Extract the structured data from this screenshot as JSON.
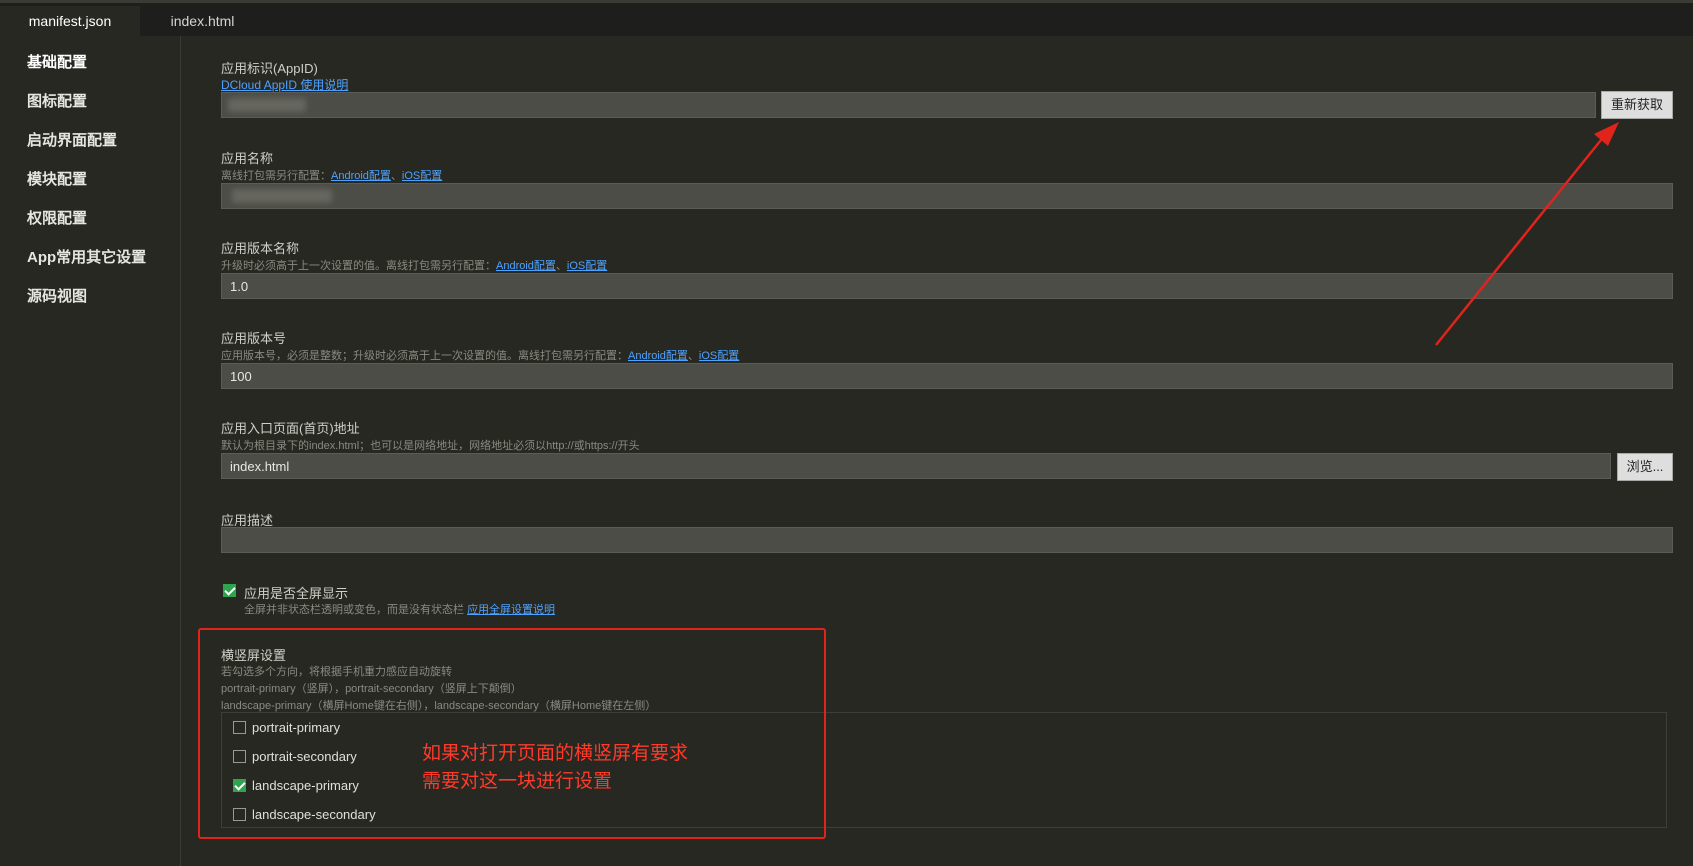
{
  "tabs": [
    {
      "label": "manifest.json",
      "active": true
    },
    {
      "label": "index.html",
      "active": false
    }
  ],
  "sidebar": {
    "items": [
      {
        "label": "基础配置",
        "active": true
      },
      {
        "label": "图标配置"
      },
      {
        "label": "启动界面配置"
      },
      {
        "label": "模块配置"
      },
      {
        "label": "权限配置"
      },
      {
        "label": "App常用其它设置"
      },
      {
        "label": "源码视图"
      }
    ]
  },
  "form": {
    "appid": {
      "label": "应用标识(AppID)",
      "help_link": "DCloud AppID 使用说明",
      "value": "",
      "button": "重新获取"
    },
    "name": {
      "label": "应用名称",
      "hint_prefix": "离线打包需另行配置：",
      "link_android": "Android配置",
      "sep": "、",
      "link_ios": "iOS配置",
      "value": ""
    },
    "version_name": {
      "label": "应用版本名称",
      "hint_prefix": "升级时必须高于上一次设置的值。离线打包需另行配置：",
      "link_android": "Android配置",
      "sep": "、",
      "link_ios": "iOS配置",
      "value": "1.0"
    },
    "version_code": {
      "label": "应用版本号",
      "hint_prefix": "应用版本号，必须是整数；升级时必须高于上一次设置的值。离线打包需另行配置：",
      "link_android": "Android配置",
      "sep": "、",
      "link_ios": "iOS配置",
      "value": "100"
    },
    "entry": {
      "label": "应用入口页面(首页)地址",
      "hint": "默认为根目录下的index.html；也可以是网络地址，网络地址必须以http://或https://开头",
      "value": "index.html",
      "button": "浏览..."
    },
    "description": {
      "label": "应用描述",
      "value": ""
    },
    "fullscreen": {
      "label": "应用是否全屏显示",
      "checked": true,
      "hint_prefix": "全屏并非状态栏透明或变色，而是没有状态栏 ",
      "link": "应用全屏设置说明"
    },
    "orientation": {
      "label": "横竖屏设置",
      "hint1": "若勾选多个方向，将根据手机重力感应自动旋转",
      "hint2": "portrait-primary（竖屏），portrait-secondary（竖屏上下颠倒）",
      "hint3": "landscape-primary（横屏Home键在右侧），landscape-secondary（横屏Home键在左侧）",
      "options": [
        {
          "label": "portrait-primary",
          "checked": false
        },
        {
          "label": "portrait-secondary",
          "checked": false
        },
        {
          "label": "landscape-primary",
          "checked": true
        },
        {
          "label": "landscape-secondary",
          "checked": false
        }
      ]
    }
  },
  "annotation": {
    "line1": "如果对打开页面的横竖屏有要求",
    "line2": "需要对这一块进行设置",
    "color": "#e0241b"
  }
}
